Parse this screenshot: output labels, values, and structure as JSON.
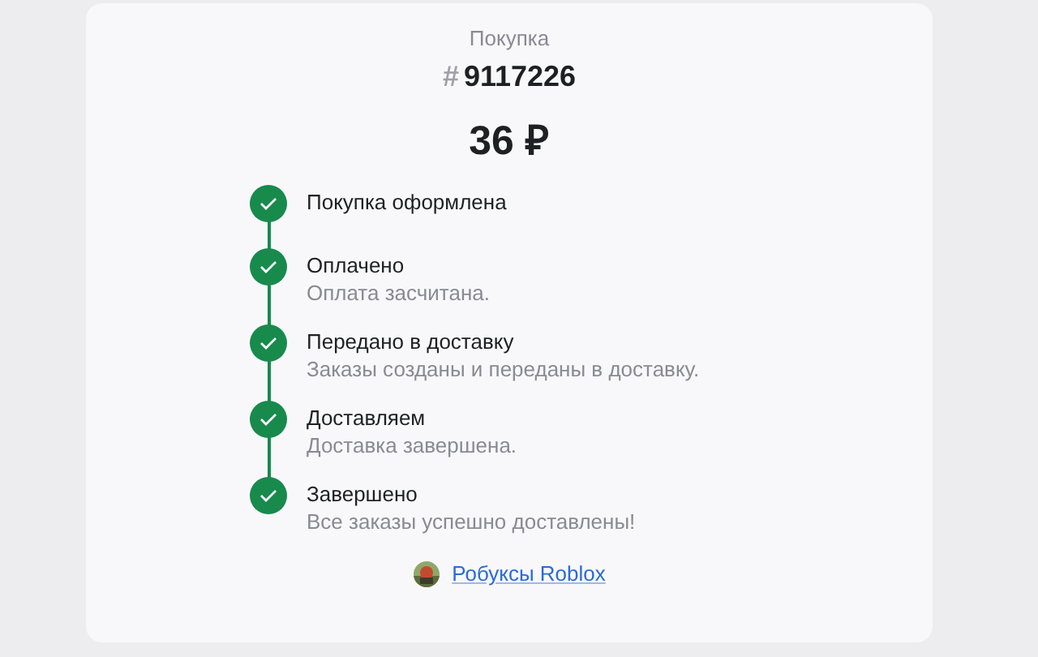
{
  "header": {
    "label": "Покупка",
    "hash": "#",
    "number": "9117226"
  },
  "price": "36 ₽",
  "steps": [
    {
      "title": "Покупка оформлена",
      "done": true
    },
    {
      "title": "Оплачено",
      "subtitle": "Оплата засчитана.",
      "done": true
    },
    {
      "title": "Передано в доставку",
      "subtitle": "Заказы созданы и переданы в доставку.",
      "done": true
    },
    {
      "title": "Доставляем",
      "subtitle": "Доставка завершена.",
      "done": true
    },
    {
      "title": "Завершено",
      "subtitle": "Все заказы успешно доставлены!",
      "done": true
    }
  ],
  "product": {
    "name": "Робуксы Roblox"
  }
}
